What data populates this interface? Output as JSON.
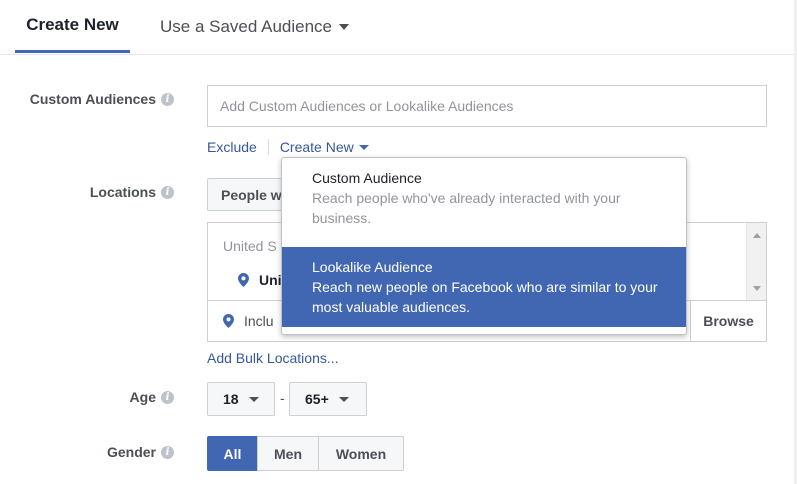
{
  "tabs": {
    "create_new": "Create New",
    "saved_audience": "Use a Saved Audience"
  },
  "custom_audiences": {
    "label": "Custom Audiences",
    "placeholder": "Add Custom Audiences or Lookalike Audiences",
    "exclude": "Exclude",
    "create_new": "Create New"
  },
  "dropdown": {
    "items": [
      {
        "title": "Custom Audience",
        "desc": "Reach people who've already interacted with your business."
      },
      {
        "title": "Lookalike Audience",
        "desc": "Reach new people on Facebook who are similar to your most valuable audiences."
      }
    ]
  },
  "locations": {
    "label": "Locations",
    "people_button": "People w",
    "country": "United S",
    "item": "Uni",
    "include": "Inclu",
    "browse": "Browse",
    "bulk": "Add Bulk Locations..."
  },
  "age": {
    "label": "Age",
    "min": "18",
    "dash": "-",
    "max": "65+"
  },
  "gender": {
    "label": "Gender",
    "options": [
      "All",
      "Men",
      "Women"
    ],
    "selected": "All"
  },
  "colors": {
    "accent": "#4267b2",
    "link": "#365899"
  }
}
